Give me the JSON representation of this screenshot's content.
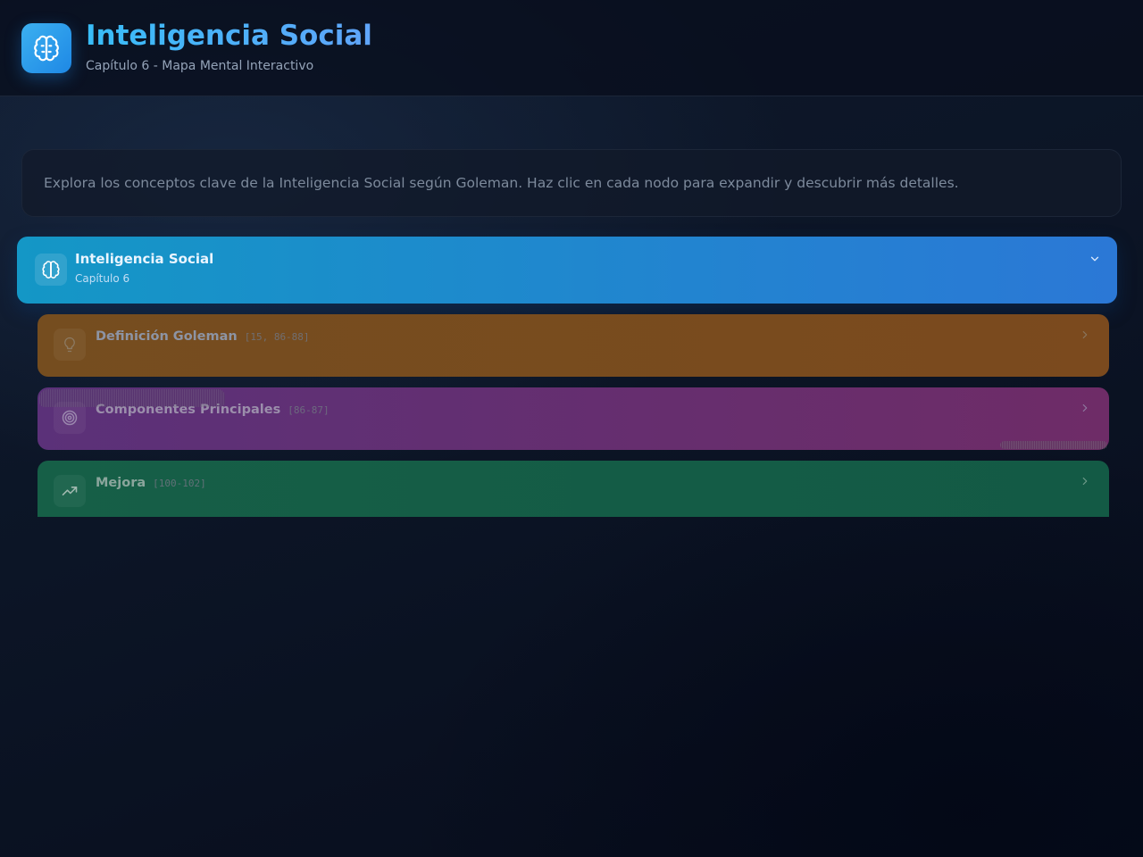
{
  "header": {
    "title": "Inteligencia Social",
    "subtitle": "Capítulo 6 - Mapa Mental Interactivo",
    "logo_icon": "brain-icon"
  },
  "intro": {
    "text": "Explora los conceptos clave de la Inteligencia Social según Goleman. Haz clic en cada nodo para expandir y descubrir más detalles."
  },
  "mindmap": {
    "root": {
      "title": "Inteligencia Social",
      "subtitle": "Capítulo 6",
      "icon": "brain-icon",
      "expanded": true,
      "color": "#1f8ad3"
    },
    "children": [
      {
        "label": "Definición Goleman",
        "pages": "[15, 86-88]",
        "icon": "lightbulb-icon",
        "color": "#784c1f"
      },
      {
        "label": "Componentes Principales",
        "pages": "[86-87]",
        "icon": "target-icon",
        "color": "#642f70"
      },
      {
        "label": "Mejora",
        "pages": "[100-102]",
        "icon": "trending-up-icon",
        "color": "#155d46"
      }
    ]
  }
}
